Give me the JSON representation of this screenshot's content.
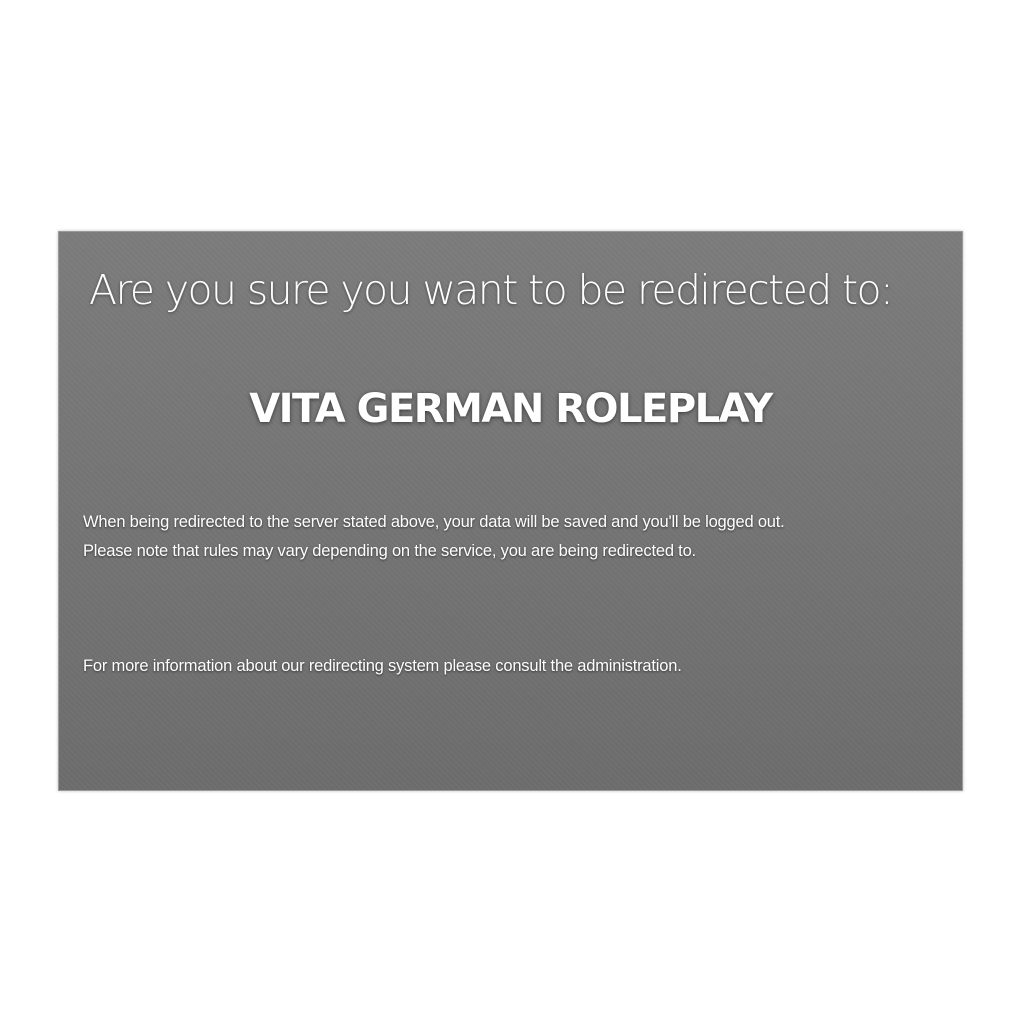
{
  "dialog": {
    "question": "Are you sure you want to be redirected to:",
    "server_name": "VITA GERMAN ROLEPLAY",
    "notice_line_1": "When being redirected to the server stated above, your data will be saved and you'll be logged out.",
    "notice_line_2": "Please note that rules may vary depending on the service, you are being redirected to.",
    "footer_info": "For more information about our redirecting system please consult the administration."
  },
  "colors": {
    "page_background": "#ffffff",
    "dialog_background": "#717171",
    "text": "#ffffff"
  }
}
